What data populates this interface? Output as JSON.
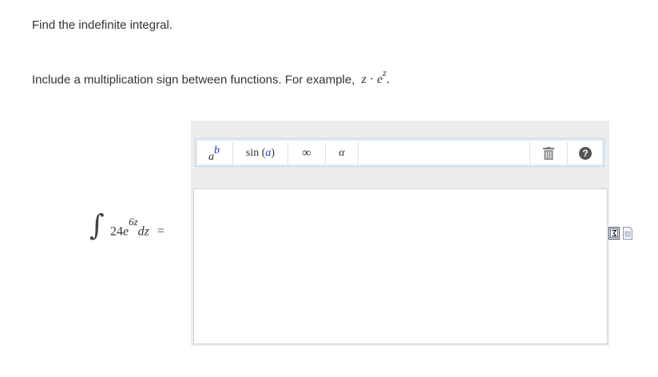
{
  "question": {
    "prompt": "Find the indefinite integral.",
    "instruction_text": "Include a multiplication sign between functions. For example,",
    "example": {
      "base": "z",
      "dot": "·",
      "exp_base": "e",
      "exp_power": "z",
      "period": "."
    }
  },
  "integral": {
    "sign": "∫",
    "coefficient": "24",
    "base": "e",
    "exponent": "6z",
    "differential": "dz",
    "equals": "="
  },
  "toolbar": {
    "power_base": "a",
    "power_exp": "b",
    "sin_prefix": "sin (",
    "sin_arg": "a",
    "sin_suffix": ")",
    "infinity": "∞",
    "alpha": "α",
    "help": "?",
    "icons": [
      "superscript-icon",
      "sine-function-icon",
      "infinity-icon",
      "alpha-icon",
      "trash-icon",
      "help-icon"
    ]
  },
  "answer": {
    "value": ""
  },
  "side_icons": [
    "math-symbol-icon",
    "document-icon"
  ]
}
